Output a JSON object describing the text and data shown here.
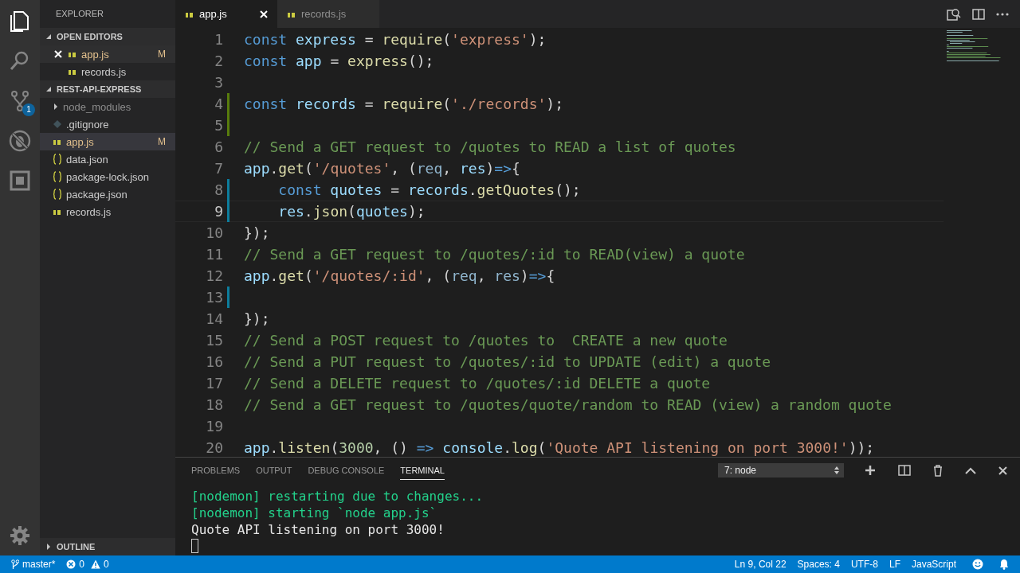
{
  "activity_bar": {
    "items": [
      {
        "kind": "explorer",
        "selected": true
      },
      {
        "kind": "search",
        "selected": false
      },
      {
        "kind": "source_control",
        "selected": false,
        "badge": "1"
      },
      {
        "kind": "debug",
        "selected": false
      },
      {
        "kind": "extensions",
        "selected": false
      }
    ]
  },
  "sidebar": {
    "title": "EXPLORER",
    "sections": [
      {
        "title": "OPEN EDITORS",
        "expanded": true,
        "items": [
          {
            "name": "app.js",
            "kind": "js",
            "selected": true,
            "modified": true,
            "status": "M",
            "closable": true
          },
          {
            "name": "records.js",
            "kind": "js",
            "selected": false,
            "modified": false,
            "closable": false
          }
        ]
      },
      {
        "title": "REST-API-EXPRESS",
        "expanded": true,
        "items": [
          {
            "name": "node_modules",
            "kind": "folder",
            "selected": false,
            "modified": false,
            "ignored": true
          },
          {
            "name": ".gitignore",
            "kind": "gitignore",
            "selected": false,
            "modified": false,
            "ignored": false
          },
          {
            "name": "app.js",
            "kind": "js",
            "selected": true,
            "modified": true,
            "status": "M",
            "ignored": false
          },
          {
            "name": "data.json",
            "kind": "json",
            "selected": false,
            "modified": false,
            "ignored": false
          },
          {
            "name": "package-lock.json",
            "kind": "json",
            "selected": false,
            "modified": false,
            "ignored": false
          },
          {
            "name": "package.json",
            "kind": "json",
            "selected": false,
            "modified": false,
            "ignored": false
          },
          {
            "name": "records.js",
            "kind": "js",
            "selected": false,
            "modified": false,
            "ignored": false
          }
        ]
      }
    ],
    "outline": {
      "title": "OUTLINE",
      "expanded": false
    }
  },
  "tabs": [
    {
      "label": "app.js",
      "kind": "js",
      "selected": true
    },
    {
      "label": "records.js",
      "kind": "js",
      "selected": false
    }
  ],
  "editor": {
    "lines": [
      {
        "number": "1",
        "added": false,
        "modified": false,
        "current": false,
        "tokens": [
          {
            "kind": "keyword",
            "text": "const"
          },
          {
            "kind": "variable",
            "text": " express"
          },
          {
            "kind": "plain",
            "text": " = "
          },
          {
            "kind": "function",
            "text": "require"
          },
          {
            "kind": "plain",
            "text": "("
          },
          {
            "kind": "string",
            "text": "'express'"
          },
          {
            "kind": "plain",
            "text": ");"
          }
        ]
      },
      {
        "number": "2",
        "added": false,
        "modified": false,
        "current": false,
        "tokens": [
          {
            "kind": "keyword",
            "text": "const"
          },
          {
            "kind": "variable",
            "text": " app"
          },
          {
            "kind": "plain",
            "text": " = "
          },
          {
            "kind": "function",
            "text": "express"
          },
          {
            "kind": "plain",
            "text": "();"
          }
        ]
      },
      {
        "number": "3",
        "added": false,
        "modified": false,
        "current": false
      },
      {
        "number": "4",
        "added": true,
        "modified": false,
        "current": false,
        "tokens": [
          {
            "kind": "keyword",
            "text": "const"
          },
          {
            "kind": "variable",
            "text": " records"
          },
          {
            "kind": "plain",
            "text": " = "
          },
          {
            "kind": "function",
            "text": "require"
          },
          {
            "kind": "plain",
            "text": "("
          },
          {
            "kind": "string",
            "text": "'./records'"
          },
          {
            "kind": "plain",
            "text": ");"
          }
        ]
      },
      {
        "number": "5",
        "added": true,
        "modified": false,
        "current": false
      },
      {
        "number": "6",
        "added": false,
        "modified": false,
        "current": false,
        "tokens": [
          {
            "kind": "comment",
            "text": "// Send a GET request to /quotes to READ a list of quotes"
          }
        ]
      },
      {
        "number": "7",
        "added": false,
        "modified": false,
        "current": false,
        "tokens": [
          {
            "kind": "variable",
            "text": "app"
          },
          {
            "kind": "plain",
            "text": "."
          },
          {
            "kind": "function",
            "text": "get"
          },
          {
            "kind": "plain",
            "text": "("
          },
          {
            "kind": "string",
            "text": "'/quotes'"
          },
          {
            "kind": "plain",
            "text": ", ("
          },
          {
            "kind": "param",
            "text": "req"
          },
          {
            "kind": "plain",
            "text": ", "
          },
          {
            "kind": "variable",
            "text": "res"
          },
          {
            "kind": "plain",
            "text": ")"
          },
          {
            "kind": "keyword",
            "text": "=>"
          },
          {
            "kind": "plain",
            "text": "{"
          }
        ]
      },
      {
        "number": "8",
        "added": false,
        "modified": true,
        "current": false,
        "indented": true,
        "tokens": [
          {
            "kind": "keyword",
            "text": "const"
          },
          {
            "kind": "variable",
            "text": " quotes"
          },
          {
            "kind": "plain",
            "text": " = "
          },
          {
            "kind": "variable",
            "text": "records"
          },
          {
            "kind": "plain",
            "text": "."
          },
          {
            "kind": "function",
            "text": "getQuotes"
          },
          {
            "kind": "plain",
            "text": "();"
          }
        ]
      },
      {
        "number": "9",
        "added": false,
        "modified": true,
        "current": true,
        "indented": true,
        "tokens": [
          {
            "kind": "variable",
            "text": "res"
          },
          {
            "kind": "plain",
            "text": "."
          },
          {
            "kind": "function",
            "text": "json"
          },
          {
            "kind": "plain",
            "text": "("
          },
          {
            "kind": "variable",
            "text": "quotes"
          },
          {
            "kind": "plain",
            "text": ");"
          }
        ]
      },
      {
        "number": "10",
        "added": false,
        "modified": false,
        "current": false,
        "tokens": [
          {
            "kind": "plain",
            "text": "});"
          }
        ]
      },
      {
        "number": "11",
        "added": false,
        "modified": false,
        "current": false,
        "tokens": [
          {
            "kind": "comment",
            "text": "// Send a GET request to /quotes/:id to READ(view) a quote"
          }
        ]
      },
      {
        "number": "12",
        "added": false,
        "modified": false,
        "current": false,
        "tokens": [
          {
            "kind": "variable",
            "text": "app"
          },
          {
            "kind": "plain",
            "text": "."
          },
          {
            "kind": "function",
            "text": "get"
          },
          {
            "kind": "plain",
            "text": "("
          },
          {
            "kind": "string",
            "text": "'/quotes/:id'"
          },
          {
            "kind": "plain",
            "text": ", ("
          },
          {
            "kind": "param",
            "text": "req"
          },
          {
            "kind": "plain",
            "text": ", "
          },
          {
            "kind": "param",
            "text": "res"
          },
          {
            "kind": "plain",
            "text": ")"
          },
          {
            "kind": "keyword",
            "text": "=>"
          },
          {
            "kind": "plain",
            "text": "{"
          }
        ]
      },
      {
        "number": "13",
        "added": false,
        "modified": true,
        "current": false
      },
      {
        "number": "14",
        "added": false,
        "modified": false,
        "current": false,
        "tokens": [
          {
            "kind": "plain",
            "text": "});"
          }
        ]
      },
      {
        "number": "15",
        "added": false,
        "modified": false,
        "current": false,
        "tokens": [
          {
            "kind": "comment",
            "text": "// Send a POST request to /quotes to  CREATE a new quote"
          }
        ]
      },
      {
        "number": "16",
        "added": false,
        "modified": false,
        "current": false,
        "tokens": [
          {
            "kind": "comment",
            "text": "// Send a PUT request to /quotes/:id to UPDATE (edit) a quote"
          }
        ]
      },
      {
        "number": "17",
        "added": false,
        "modified": false,
        "current": false,
        "tokens": [
          {
            "kind": "comment",
            "text": "// Send a DELETE request to /quotes/:id DELETE a quote"
          }
        ]
      },
      {
        "number": "18",
        "added": false,
        "modified": false,
        "current": false,
        "tokens": [
          {
            "kind": "comment",
            "text": "// Send a GET request to /quotes/quote/random to READ (view) a random quote"
          }
        ]
      },
      {
        "number": "19",
        "added": false,
        "modified": false,
        "current": false
      },
      {
        "number": "20",
        "added": false,
        "modified": false,
        "current": false,
        "tokens": [
          {
            "kind": "variable",
            "text": "app"
          },
          {
            "kind": "plain",
            "text": "."
          },
          {
            "kind": "function",
            "text": "listen"
          },
          {
            "kind": "plain",
            "text": "("
          },
          {
            "kind": "number",
            "text": "3000"
          },
          {
            "kind": "plain",
            "text": ", () "
          },
          {
            "kind": "keyword",
            "text": "=>"
          },
          {
            "kind": "variable",
            "text": " console"
          },
          {
            "kind": "plain",
            "text": "."
          },
          {
            "kind": "function",
            "text": "log"
          },
          {
            "kind": "plain",
            "text": "("
          },
          {
            "kind": "string",
            "text": "'Quote API listening on port 3000!'"
          },
          {
            "kind": "plain",
            "text": "));"
          }
        ]
      }
    ]
  },
  "panel": {
    "tabs": [
      {
        "label": "PROBLEMS",
        "selected": false
      },
      {
        "label": "OUTPUT",
        "selected": false
      },
      {
        "label": "DEBUG CONSOLE",
        "selected": false
      },
      {
        "label": "TERMINAL",
        "selected": true
      }
    ],
    "terminal_select": {
      "value": "7: node"
    },
    "terminal_lines": [
      {
        "text": "[nodemon] restarting due to changes...",
        "kind": "info"
      },
      {
        "text": "[nodemon] starting `node app.js`",
        "kind": "info"
      },
      {
        "text": "Quote API listening on port 3000!",
        "kind": "output"
      }
    ]
  },
  "status_bar": {
    "branch": "master*",
    "errors": "0",
    "warnings": "0",
    "items": [
      "Ln 9, Col 22",
      "Spaces: 4",
      "UTF-8",
      "LF",
      "JavaScript"
    ]
  }
}
